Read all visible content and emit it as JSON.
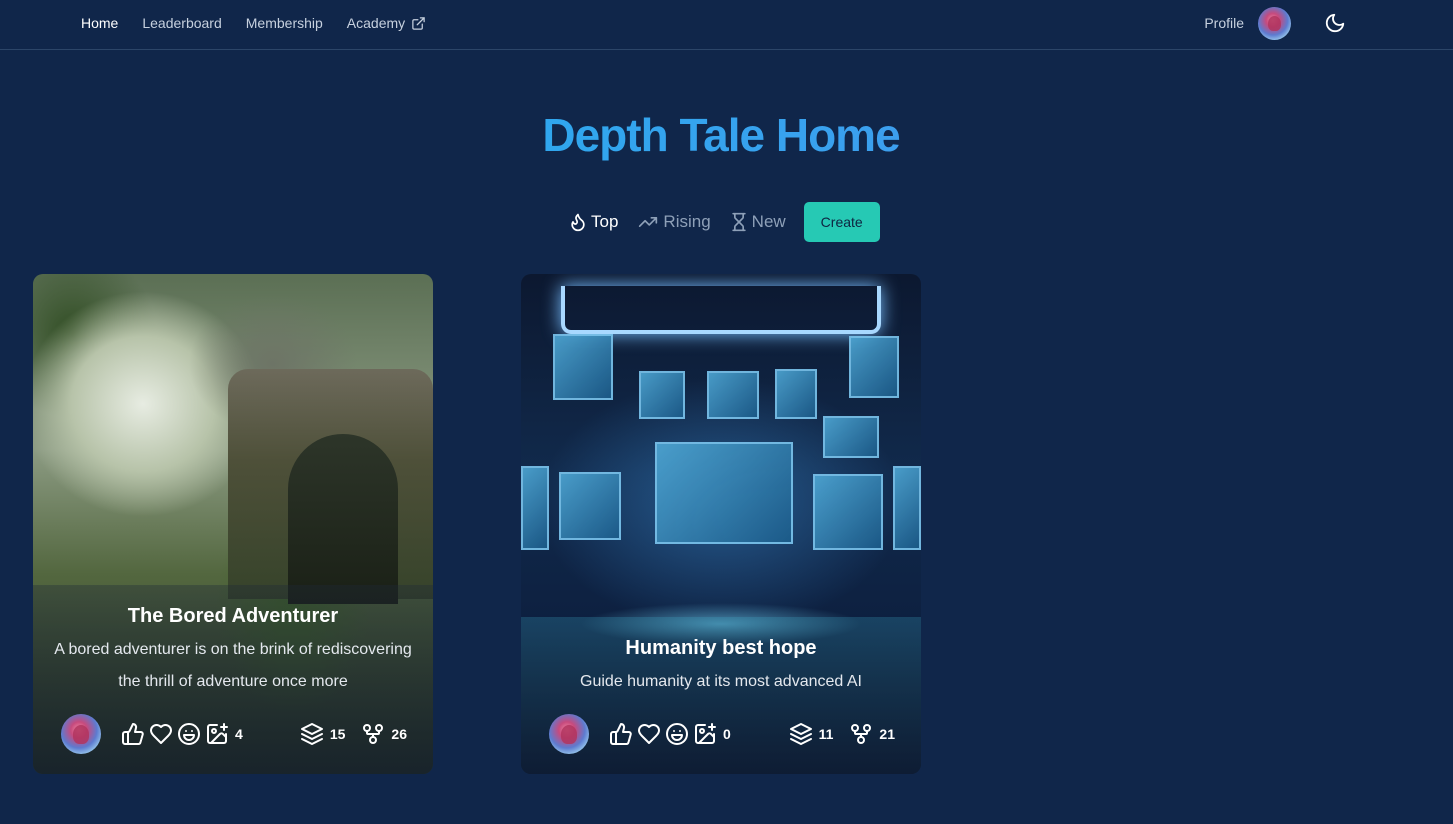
{
  "nav": {
    "links": [
      {
        "label": "Home"
      },
      {
        "label": "Leaderboard"
      },
      {
        "label": "Membership"
      },
      {
        "label": "Academy"
      }
    ],
    "profile_label": "Profile"
  },
  "page": {
    "title": "Depth Tale Home"
  },
  "filters": {
    "top": "Top",
    "rising": "Rising",
    "new": "New",
    "create": "Create"
  },
  "cards": [
    {
      "title": "The Bored Adventurer",
      "description": "A bored adventurer is on the brink of rediscovering the thrill of adventure once more",
      "image_count": "4",
      "layers": "15",
      "forks": "26"
    },
    {
      "title": "Humanity best hope",
      "description": "Guide humanity at its most advanced AI",
      "image_count": "0",
      "layers": "11",
      "forks": "21"
    }
  ],
  "colors": {
    "background": "#10264a",
    "accent_create": "#26c9b4",
    "title_gradient_start": "#1fb2ee",
    "title_gradient_end": "#6a82f0"
  },
  "icons": [
    "external-link-icon",
    "moon-icon",
    "flame-icon",
    "trending-up-icon",
    "hourglass-icon",
    "thumbs-up-icon",
    "heart-icon",
    "smile-icon",
    "image-plus-icon",
    "layers-icon",
    "fork-icon"
  ]
}
